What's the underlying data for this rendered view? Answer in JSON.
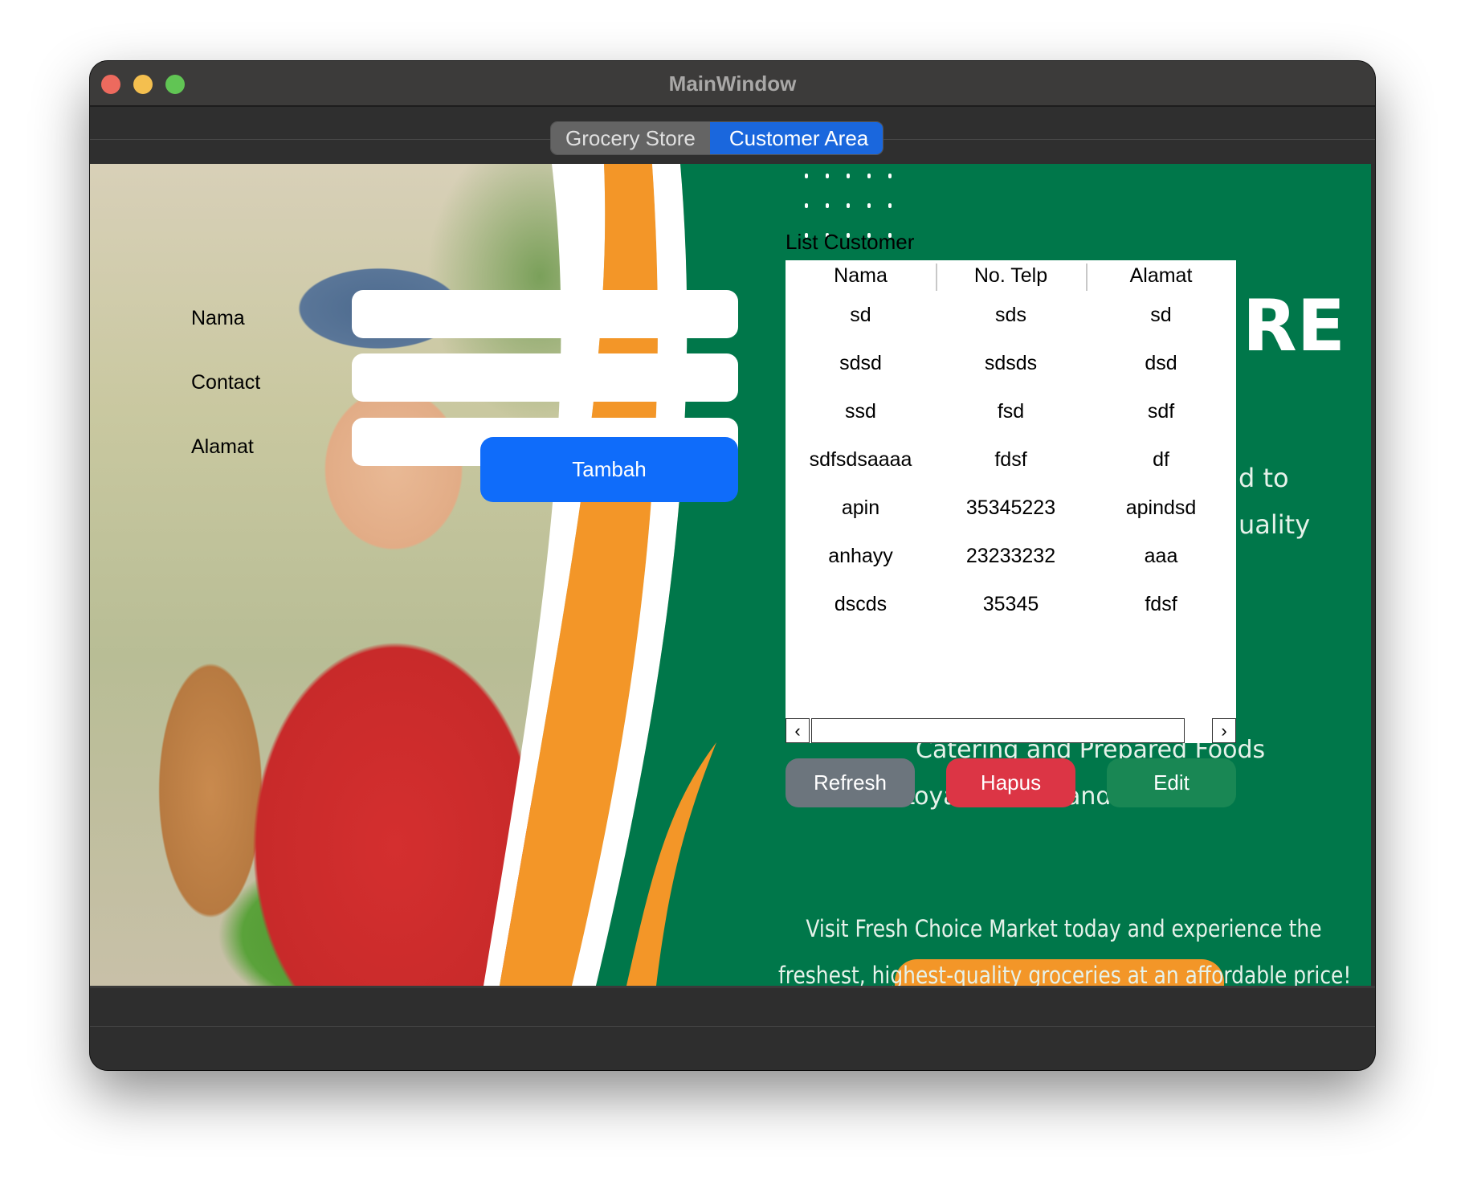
{
  "window": {
    "title": "MainWindow"
  },
  "tabs": [
    {
      "label": "Grocery Store",
      "active": false
    },
    {
      "label": "Customer Area",
      "active": true
    }
  ],
  "form": {
    "nama_label": "Nama",
    "contact_label": "Contact",
    "alamat_label": "Alamat",
    "nama_value": "",
    "contact_value": "",
    "alamat_value": "",
    "submit_label": "Tambah"
  },
  "list": {
    "title": "List Customer",
    "columns": [
      "Nama",
      "No. Telp",
      "Alamat"
    ],
    "rows": [
      [
        "sd",
        "sds",
        "sd"
      ],
      [
        "sdsd",
        "sdsds",
        "dsd"
      ],
      [
        "ssd",
        "fsd",
        "sdf"
      ],
      [
        "sdfsdsaaaa",
        "fdsf",
        "df"
      ],
      [
        "apin",
        "35345223",
        "apindsd"
      ],
      [
        "anhayy",
        "23233232",
        "aaa"
      ],
      [
        "dscds",
        "35345",
        "fdsf"
      ]
    ]
  },
  "actions": {
    "refresh": "Refresh",
    "hapus": "Hapus",
    "edit": "Edit"
  },
  "banner": {
    "heading_fragment": "RE",
    "line_fragment_1": "d to",
    "line_fragment_2": "uality",
    "catering": "Catering and Prepared Foods",
    "loyalty_fragment_1": "Loya",
    "loyalty_fragment_2": "and",
    "visit_line_1": "Visit Fresh Choice Market today and experience the",
    "visit_line_2": "freshest, highest-quality groceries at an affordable price!"
  },
  "colors": {
    "accent_blue": "#0f6cfa",
    "refresh": "#6c757d",
    "hapus": "#dc3545",
    "edit": "#198754",
    "banner_green": "#00774a",
    "banner_orange": "#f39628"
  }
}
